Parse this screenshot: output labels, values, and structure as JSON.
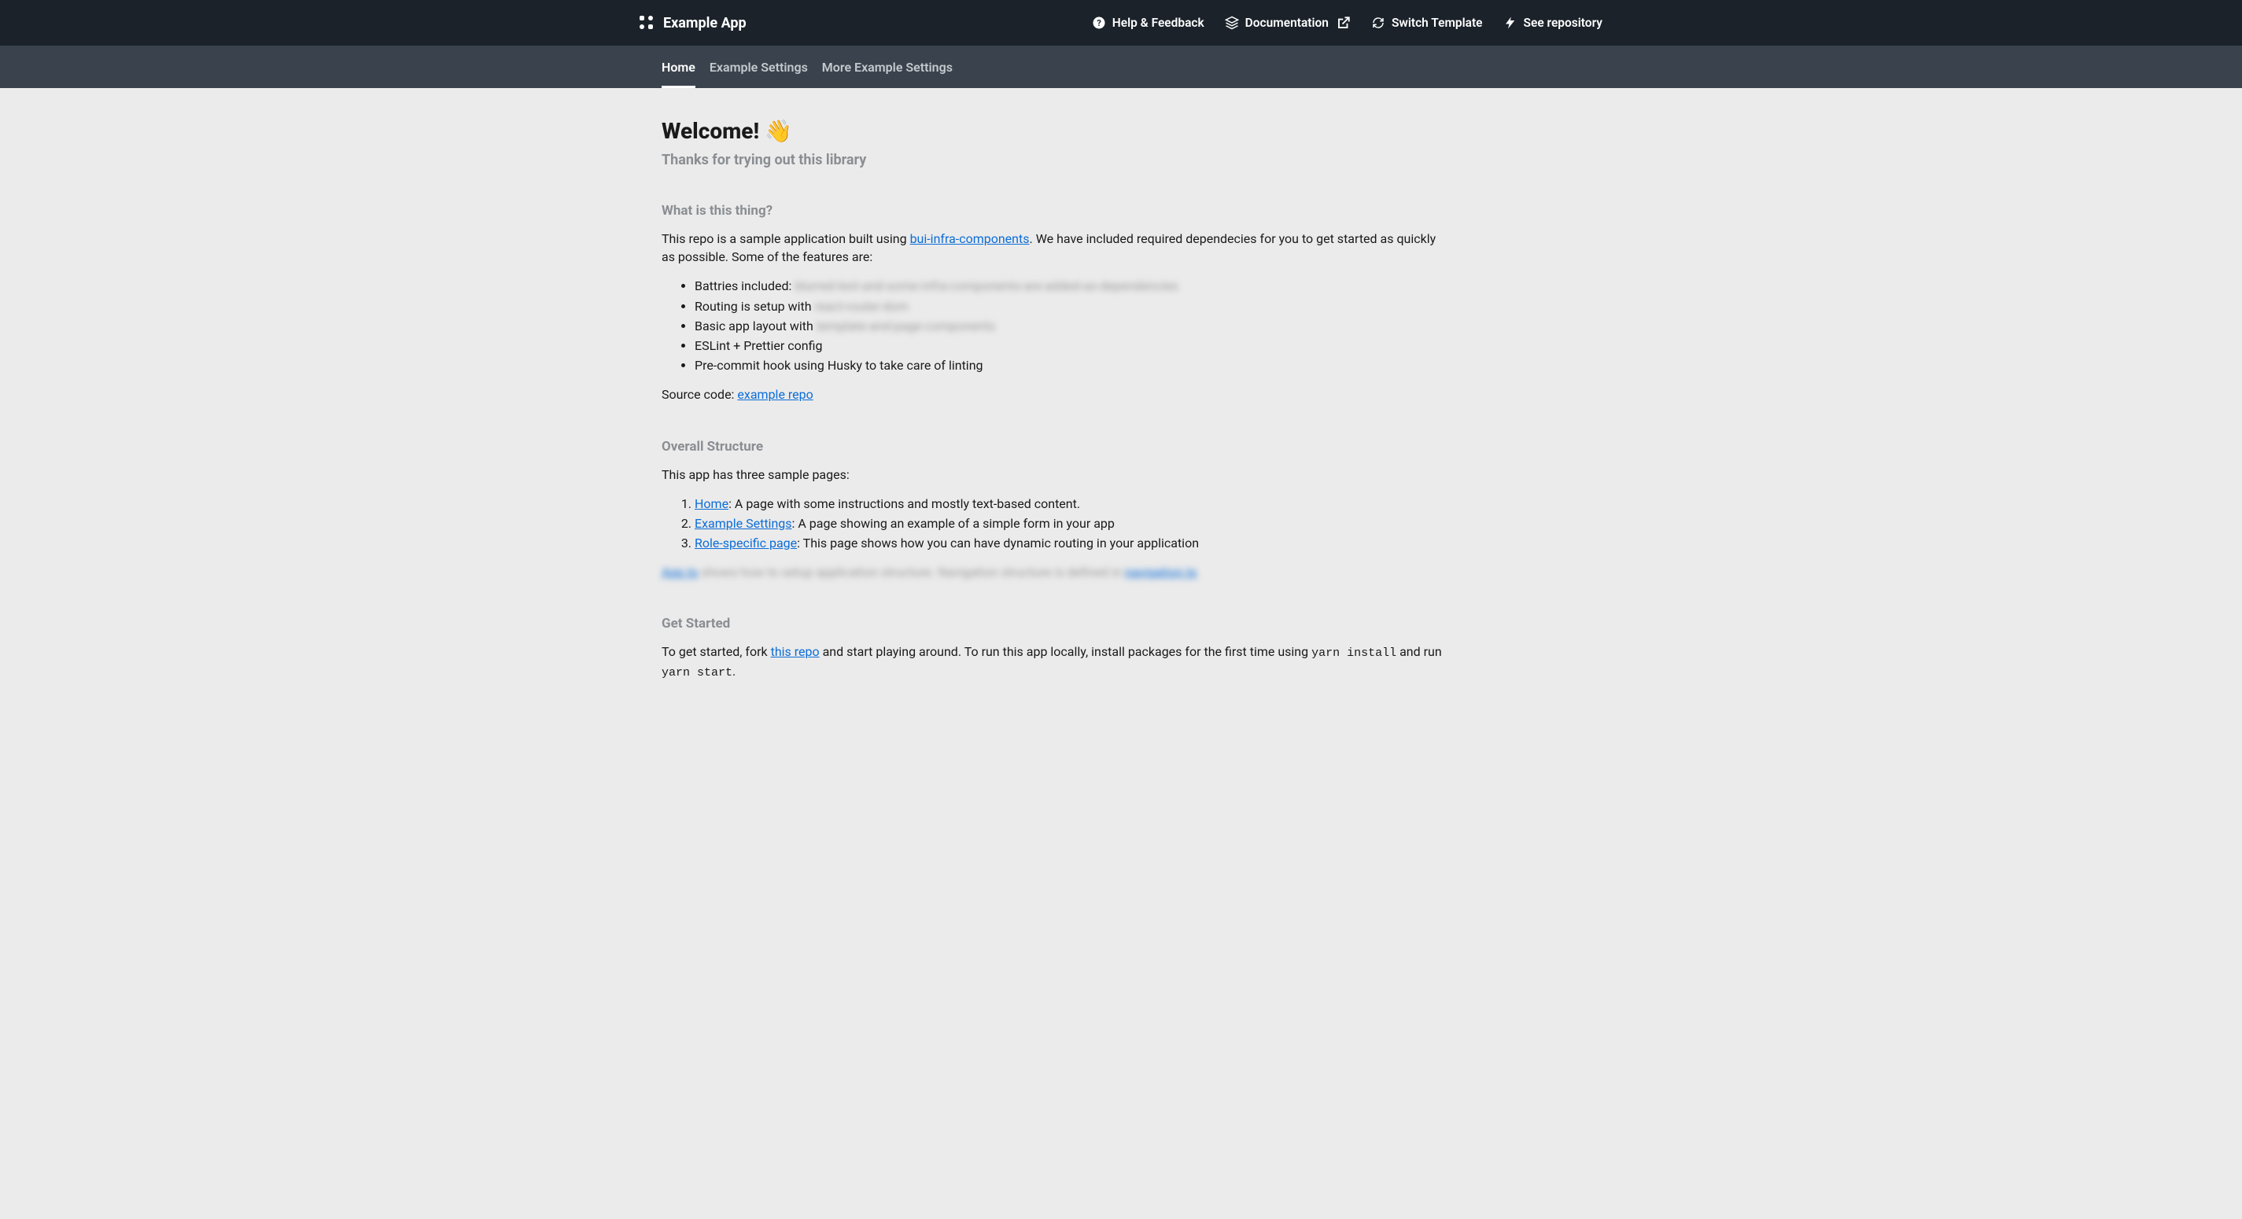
{
  "header": {
    "app_title": "Example App",
    "links": {
      "help": "Help & Feedback",
      "docs": "Documentation",
      "switch": "Switch Template",
      "repo": "See repository"
    }
  },
  "nav": {
    "tabs": [
      {
        "label": "Home",
        "active": true
      },
      {
        "label": "Example Settings",
        "active": false
      },
      {
        "label": "More Example Settings",
        "active": false
      }
    ]
  },
  "page": {
    "welcome_heading": "Welcome! 👋",
    "subtitle": "Thanks for trying out this library",
    "section_what": {
      "heading": "What is this thing?",
      "intro_before_link": "This repo is a sample application built using ",
      "intro_link": "bui-infra-components",
      "intro_after_link": ". We have included required dependecies for you to get started as quickly as possible. Some of the features are:",
      "bullets": [
        {
          "prefix": "Battries included: ",
          "blurred": "blurred-text-and-some-infra-components-are-added-as-dependencies"
        },
        {
          "prefix": "Routing is setup with ",
          "blurred": "react-router-dom"
        },
        {
          "prefix": "Basic app layout with ",
          "blurred": "template-and-page-components"
        },
        {
          "prefix": "ESLint + Prettier config",
          "blurred": ""
        },
        {
          "prefix": "Pre-commit hook using Husky to take care of linting",
          "blurred": ""
        }
      ],
      "source_prefix": "Source code: ",
      "source_link": "example repo"
    },
    "section_structure": {
      "heading": "Overall Structure",
      "intro": "This app has three sample pages:",
      "items": [
        {
          "link": "Home",
          "desc": ": A page with some instructions and mostly text-based content."
        },
        {
          "link": "Example Settings",
          "desc": ": A page showing an example of a simple form in your app"
        },
        {
          "link": "Role-specific page",
          "desc": ": This page shows how you can have dynamic routing in your application"
        }
      ],
      "blurred_line": {
        "link1": "App.ts",
        "mid": " shows how to setup application structure. Navigation structure is defined in ",
        "link2": "navigation.ts"
      }
    },
    "section_getstarted": {
      "heading": "Get Started",
      "text_before_link": "To get started, fork ",
      "link": "this repo",
      "text_mid1": " and start playing around. To run this app locally, install packages for the first time using ",
      "code1": "yarn install",
      "text_mid2": " and run ",
      "code2": "yarn start",
      "text_end": "."
    }
  }
}
